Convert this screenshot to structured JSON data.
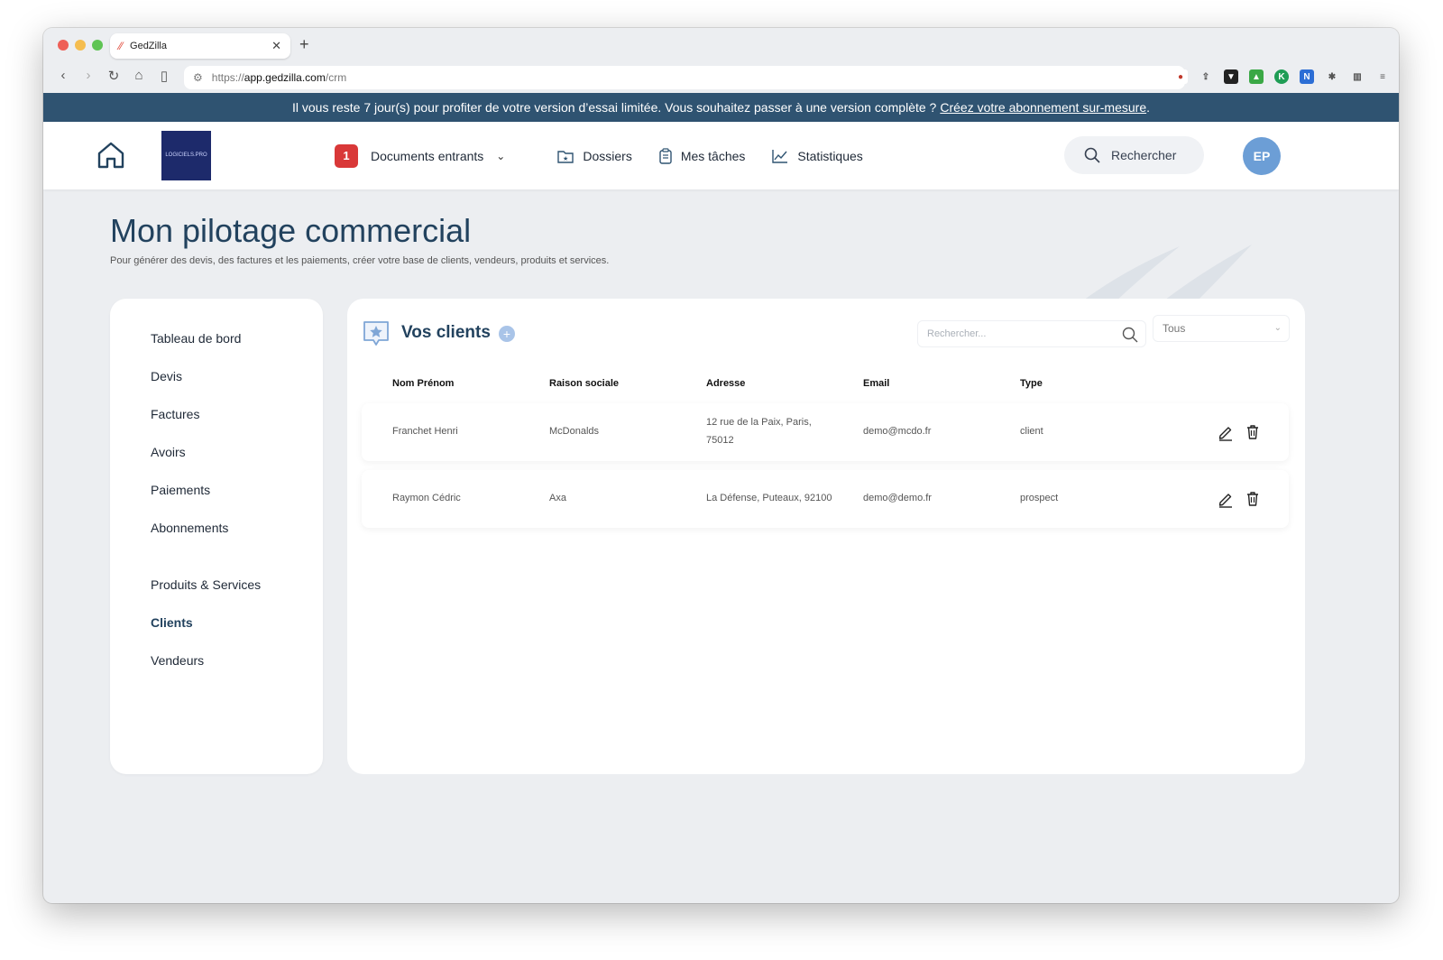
{
  "browser": {
    "tab_title": "GedZilla",
    "url_prefix": "https://",
    "url_host": "app.gedzilla.com",
    "url_path": "/crm"
  },
  "banner": {
    "text": "Il vous reste 7 jour(s) pour profiter de votre version d’essai limitée. Vous souhaitez passer à une version complète ?",
    "link": "Créez votre abonnement sur-mesure",
    "suffix": "."
  },
  "logo": {
    "text": "LOGICIELS.PRO"
  },
  "nav": {
    "badge_count": "1",
    "documents": "Documents entrants",
    "dossiers": "Dossiers",
    "taches": "Mes tâches",
    "stats": "Statistiques",
    "search": "Rechercher",
    "avatar": "EP"
  },
  "page": {
    "title": "Mon pilotage commercial",
    "subtitle": "Pour générer des devis, des factures et les paiements, créer votre base de clients, vendeurs, produits et services."
  },
  "sidebar": {
    "items": [
      {
        "label": "Tableau de bord"
      },
      {
        "label": "Devis"
      },
      {
        "label": "Factures"
      },
      {
        "label": "Avoirs"
      },
      {
        "label": "Paiements"
      },
      {
        "label": "Abonnements"
      },
      {
        "label": "Produits & Services"
      },
      {
        "label": "Clients",
        "active": true
      },
      {
        "label": "Vendeurs"
      }
    ]
  },
  "clients": {
    "title": "Vos clients",
    "search_placeholder": "Rechercher...",
    "filter_value": "Tous",
    "columns": [
      "Nom Prénom",
      "Raison sociale",
      "Adresse",
      "Email",
      "Type"
    ],
    "rows": [
      {
        "name": "Franchet Henri",
        "company": "McDonalds",
        "address_line1": "12 rue de la Paix, Paris,",
        "address_line2": "75012",
        "email": "demo@mcdo.fr",
        "type": "client"
      },
      {
        "name": "Raymon Cédric",
        "company": "Axa",
        "address_line1": "La Défense, Puteaux, 92100",
        "address_line2": "",
        "email": "demo@demo.fr",
        "type": "prospect"
      }
    ]
  },
  "colors": {
    "banner": "#2f5371",
    "title": "#22425e",
    "badge": "#d93838",
    "avatar": "#6c9ed6"
  }
}
